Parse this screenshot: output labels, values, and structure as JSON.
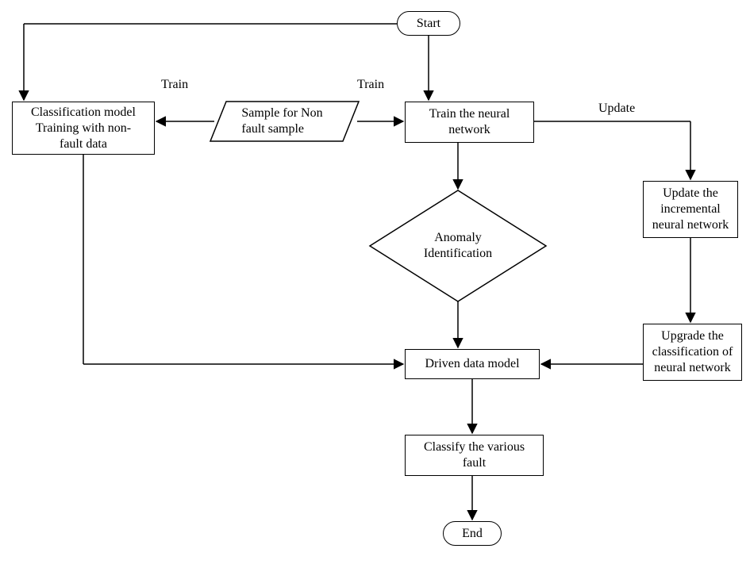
{
  "nodes": {
    "start": "Start",
    "classModel": "Classification model\nTraining with non-\nfault data",
    "sampleNonFault": "Sample for Non\nfault sample",
    "trainNN": "Train the neural\nnetwork",
    "anomaly": "Anomaly\nIdentification",
    "updateIncNN": "Update the\nincremental\nneural network",
    "upgradeClass": "Upgrade the\nclassification of\nneural network",
    "driven": "Driven data model",
    "classify": "Classify the various\nfault",
    "end": "End"
  },
  "labels": {
    "edgeTrain1": "Train",
    "edgeTrain2": "Train",
    "edgeUpdate": "Update"
  }
}
